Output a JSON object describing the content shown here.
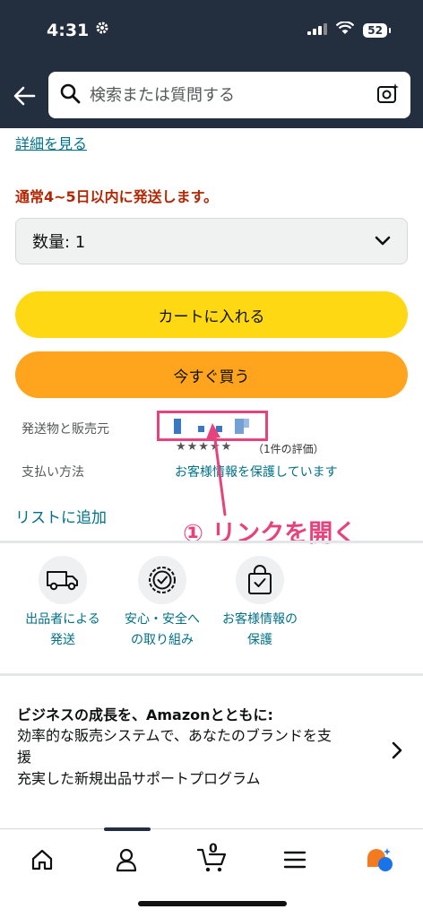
{
  "status_bar": {
    "time": "4:31",
    "battery": "52"
  },
  "search": {
    "placeholder": "検索または質問する"
  },
  "product": {
    "see_details": "詳細を見る",
    "delivery_text": "通常4~5日以内に発送します。",
    "quantity_label": "数量: 1",
    "add_to_cart": "カートに入れる",
    "buy_now": "今すぐ買う",
    "ships_from_label": "発送物と販売元",
    "rating_stars": "★★★★★",
    "rating_count": "（1件の評価）",
    "payment_label": "支払い方法",
    "payment_link": "お客様情報を保護しています",
    "add_to_list": "リストに追加"
  },
  "annotation": {
    "text": "① リンクを開く",
    "color": "#e6437c"
  },
  "features": [
    {
      "label_line1": "出品者による",
      "label_line2": "発送",
      "icon": "truck-icon"
    },
    {
      "label_line1": "安心・安全へ",
      "label_line2": "の取り組み",
      "icon": "badge-check-icon"
    },
    {
      "label_line1": "お客様情報の",
      "label_line2": "保護",
      "icon": "secure-bag-icon"
    }
  ],
  "business": {
    "title": "ビジネスの成長を、Amazonとともに:",
    "line1": "効率的な販売システムで、あなたのブランドを支",
    "line2": "援",
    "line3": "充実した新規出品サポートプログラム"
  },
  "bottom_nav": {
    "cart_count": "0"
  },
  "colors": {
    "header": "#232f3e",
    "cart_button": "#ffd814",
    "buy_button": "#ffa41c",
    "link": "#007185",
    "delivery": "#b12704"
  }
}
